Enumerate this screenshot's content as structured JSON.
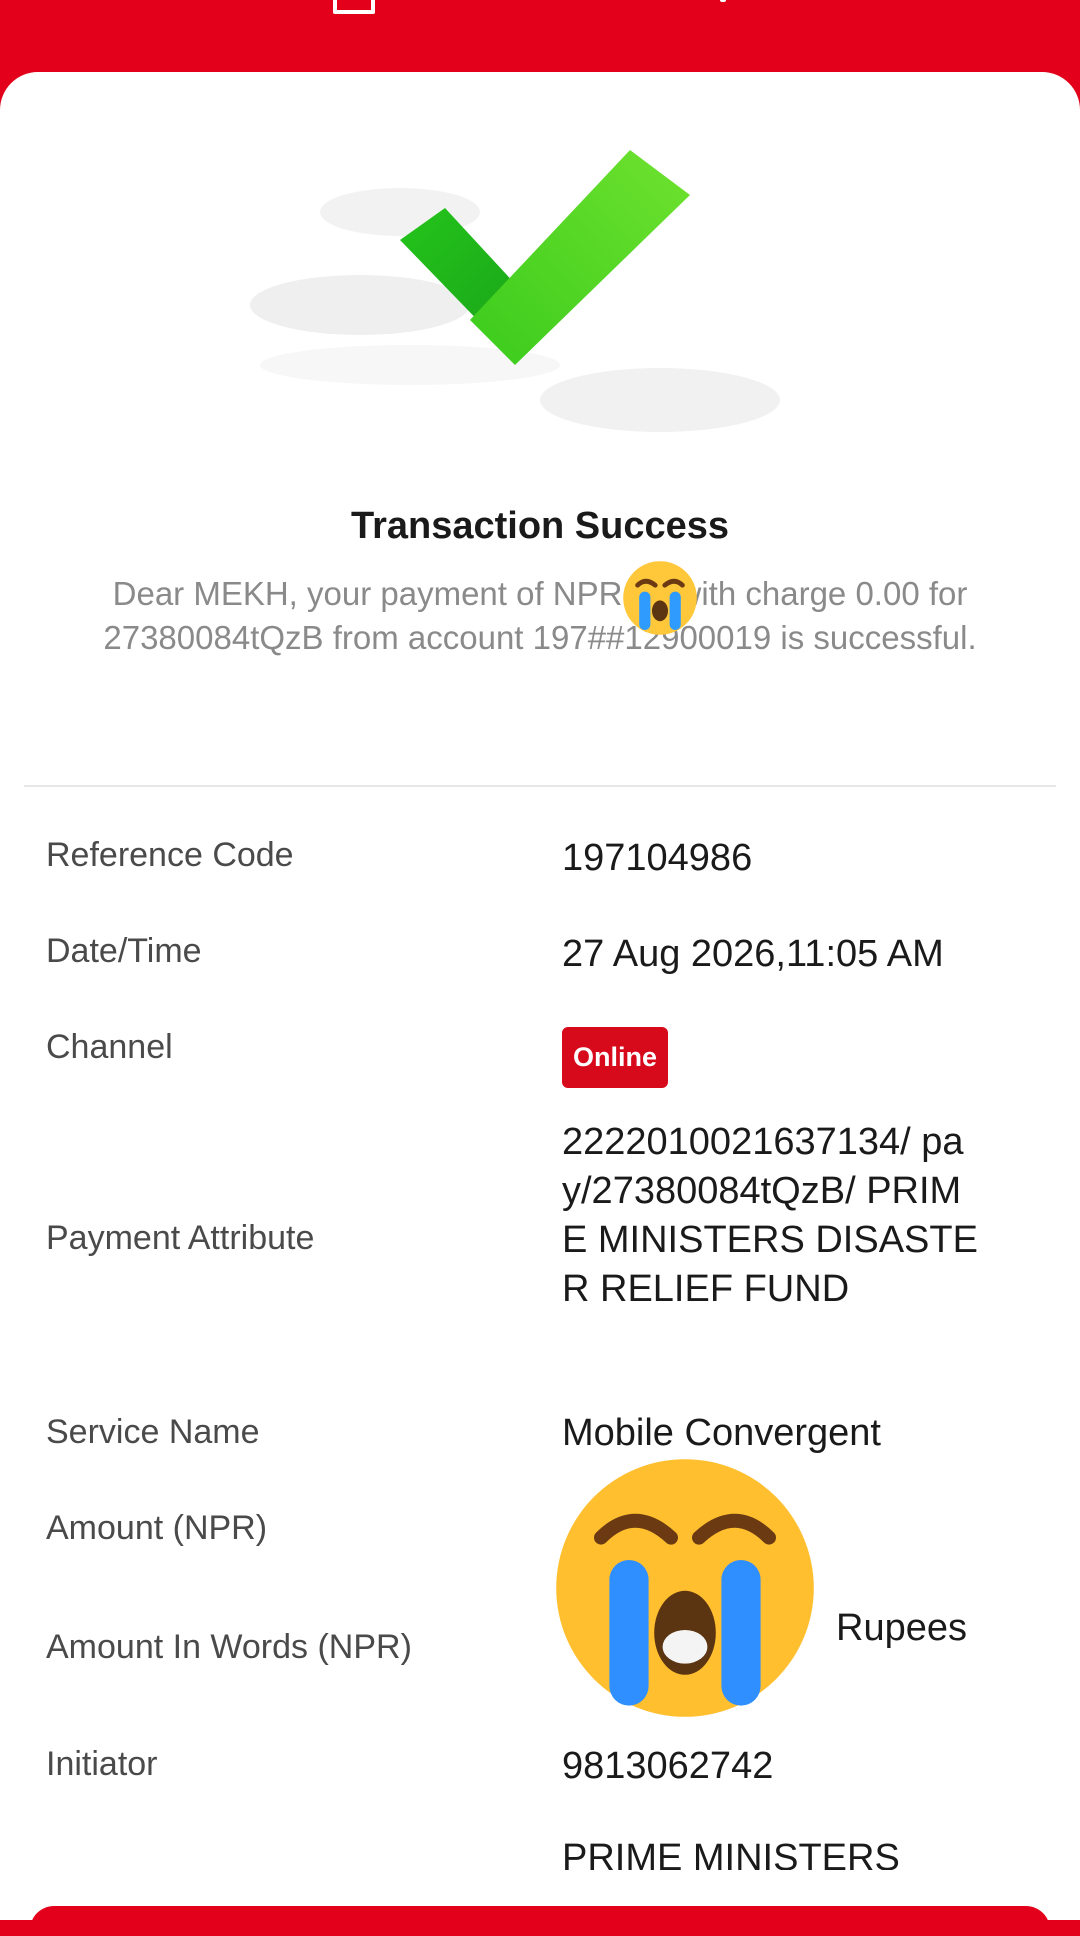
{
  "status": {
    "title": "Transaction Success",
    "message": "Dear MEKH, your payment of NPR        00 with charge 0.00 for 27380084tQzB from account 197##12900019 is successful."
  },
  "details": {
    "reference_code": {
      "label": "Reference Code",
      "value": "197104986"
    },
    "date_time": {
      "label": "Date/Time",
      "value": "27 Aug 2026,11:05 AM"
    },
    "channel": {
      "label": "Channel",
      "value": "Online"
    },
    "payment_attribute": {
      "label": "Payment Attribute",
      "value": "2222010021637134/ pay/27380084tQzB/ PRIME MINISTERS DISASTER RELIEF FUND"
    },
    "service_name": {
      "label": "Service Name",
      "value": "Mobile Convergent"
    },
    "amount": {
      "label": "Amount (NPR)",
      "value": ""
    },
    "amount_words": {
      "label": "Amount In Words (NPR)",
      "value": "Rupees"
    },
    "initiator": {
      "label": "Initiator",
      "value": "9813062742"
    },
    "partial_row": {
      "value": "PRIME MINISTERS"
    }
  },
  "icons": {
    "success": "checkmark-icon",
    "overlay": "crying-face-emoji"
  },
  "colors": {
    "brand": "#e2001a",
    "success_green": "#3ccf1f",
    "badge": "#d60a1a"
  }
}
